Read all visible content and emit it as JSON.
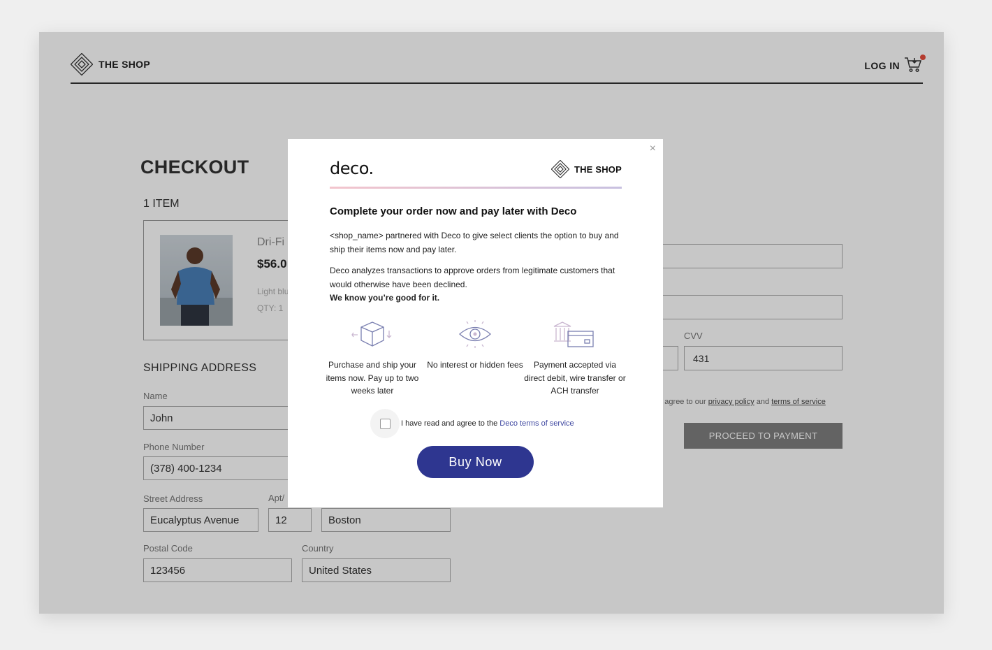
{
  "header": {
    "brand": "THE SHOP",
    "login": "LOG IN"
  },
  "checkout": {
    "title": "CHECKOUT",
    "items_count": "1 ITEM",
    "item": {
      "name": "Dri-Fi",
      "price": "$56.0",
      "color": "Light blu",
      "qty": "QTY: 1"
    }
  },
  "shipping": {
    "title": "SHIPPING ADDRESS",
    "name_label": "Name",
    "name_value": "John",
    "phone_label": "Phone Number",
    "phone_value": "(378) 400-1234",
    "street_label": "Street Address",
    "street_value": "Eucalyptus Avenue",
    "apt_label": "Apt/",
    "apt_value": "12",
    "city_value": "Boston",
    "postal_label": "Postal Code",
    "postal_value": "123456",
    "country_label": "Country",
    "country_value": "United States"
  },
  "payment": {
    "cvv_label": "CVV",
    "cvv_value": "431",
    "terms_prefix": "ou agree to our",
    "privacy_link": "privacy policy",
    "terms_and": "and",
    "terms_link": "terms of service",
    "proceed_label": "PROCEED TO PAYMENT"
  },
  "modal": {
    "close": "×",
    "logo": "deco.",
    "brand": "THE SHOP",
    "heading": "Complete your order now and pay later with Deco",
    "para1": "<shop_name> partnered with Deco to give select clients the option to buy and ship their items now and pay later.",
    "para2": "Deco analyzes transactions to approve orders from legitimate customers that would otherwise have been declined.",
    "para2_bold": "We know you’re good for it.",
    "features": [
      {
        "icon": "box-icon",
        "text": "Purchase and ship your items now. Pay up to two weeks later"
      },
      {
        "icon": "eye-icon",
        "text": "No interest or hidden fees"
      },
      {
        "icon": "bank-card-icon",
        "text": "Payment accepted via direct debit, wire transfer or ACH transfer"
      }
    ],
    "agree_text": "I have read and agree to the",
    "agree_link": "Deco terms of service",
    "buy_label": "Buy Now"
  },
  "colors": {
    "accent": "#2e3690",
    "divider_start": "#f3c5cd",
    "divider_end": "#c8c1e0",
    "cart_badge": "#e74c3c"
  }
}
